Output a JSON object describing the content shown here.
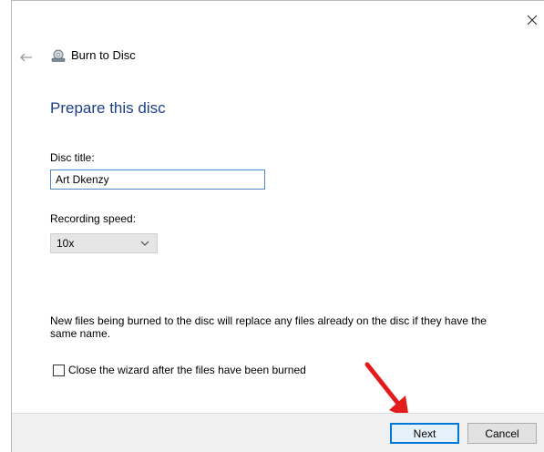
{
  "window": {
    "app_title": "Burn to Disc",
    "close_glyph": "×",
    "back_glyph": "←"
  },
  "page": {
    "heading": "Prepare this disc",
    "disc_title_label": "Disc title:",
    "disc_title_value": "Art Dkenzy",
    "recording_speed_label": "Recording speed:",
    "recording_speed_value": "10x",
    "info_text": "New files being burned to the disc will replace any files already on the disc if they have the same name.",
    "close_wizard_label": "Close the wizard after the files have been burned",
    "close_wizard_checked": false
  },
  "footer": {
    "next_label": "Next",
    "cancel_label": "Cancel"
  },
  "colors": {
    "heading": "#1e3f87",
    "focus_border": "#0078d7",
    "annotation_arrow": "#e31b1b"
  },
  "icons": {
    "close": "close-icon",
    "back": "back-arrow-icon",
    "disc_burner": "disc-burner-icon",
    "dropdown": "chevron-down-icon",
    "annotation": "red-arrow-annotation"
  }
}
